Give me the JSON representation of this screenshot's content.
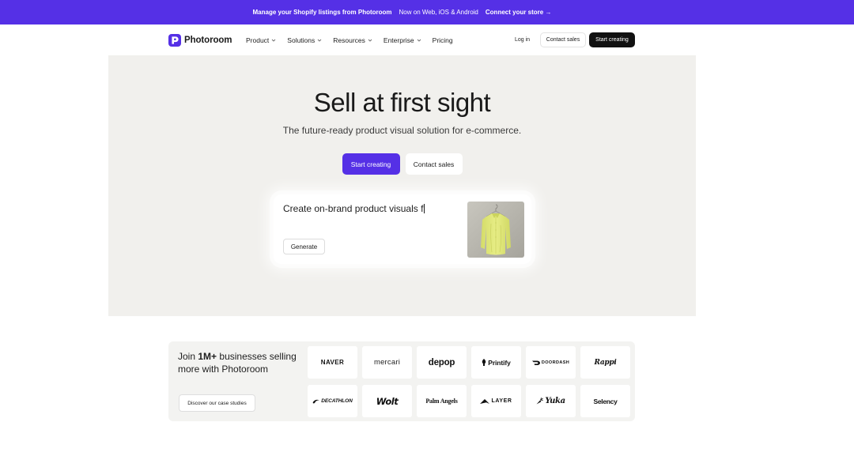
{
  "banner": {
    "shopify_text": "Manage your Shopify listings from Photoroom",
    "platforms_text": "Now on Web, iOS & Android",
    "cta_text": "Connect your store →"
  },
  "nav": {
    "brand_name": "Photoroom",
    "brand_icon": "photoroom-logo-icon",
    "chevron_icon": "chevron-down-icon",
    "items": [
      {
        "label": "Product",
        "has_dropdown": true
      },
      {
        "label": "Solutions",
        "has_dropdown": true
      },
      {
        "label": "Resources",
        "has_dropdown": true
      },
      {
        "label": "Enterprise",
        "has_dropdown": true
      },
      {
        "label": "Pricing",
        "has_dropdown": false
      }
    ],
    "login_label": "Log in",
    "contact_sales_label": "Contact sales",
    "start_creating_label": "Start creating"
  },
  "hero": {
    "title": "Sell at first sight",
    "subtitle": "The future-ready product visual solution for e-commerce.",
    "primary_cta_label": "Start creating",
    "secondary_cta_label": "Contact sales",
    "prompt_card": {
      "prompt_value": "Create on-brand product visuals f",
      "generate_label": "Generate"
    }
  },
  "social_proof": {
    "heading_prefix": "Join",
    "heading_highlight": "1M+",
    "heading_suffix": "businesses selling more with Photoroom",
    "case_studies_label": "Discover our case studies",
    "logos": [
      {
        "name": "NAVER"
      },
      {
        "name": "mercari"
      },
      {
        "name": "depop"
      },
      {
        "name": "Printify",
        "icon": "printify-icon"
      },
      {
        "name": "DOORDASH",
        "icon": "doordash-icon"
      },
      {
        "name": "Rappi"
      },
      {
        "name": "DECATHLON",
        "icon": "decathlon-icon"
      },
      {
        "name": "Wolt"
      },
      {
        "name": "Palm Angels"
      },
      {
        "name": "LAYER",
        "icon": "layer-icon"
      },
      {
        "name": "Yuka",
        "icon": "yuka-icon"
      },
      {
        "name": "Selency"
      }
    ]
  },
  "colors": {
    "brand_purple": "#5530e6",
    "hero_background": "#f1f0ed",
    "panel_background": "#f3f3f1",
    "dark_button": "#111111",
    "text_primary": "#1b1b1b"
  }
}
